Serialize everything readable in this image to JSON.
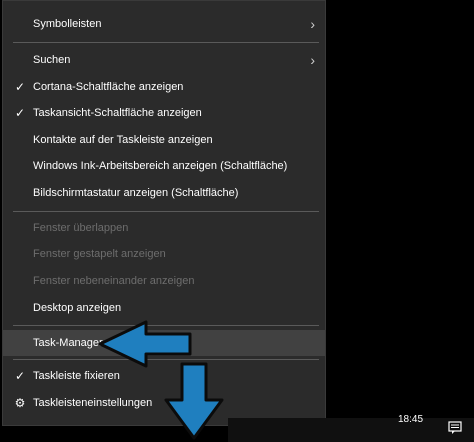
{
  "menu": {
    "items": [
      {
        "label": "Symbolleisten",
        "has_submenu": true
      },
      {
        "label": "Suchen",
        "has_submenu": true
      },
      {
        "label": "Cortana-Schaltfläche anzeigen",
        "checked": true
      },
      {
        "label": "Taskansicht-Schaltfläche anzeigen",
        "checked": true
      },
      {
        "label": "Kontakte auf der Taskleiste anzeigen"
      },
      {
        "label": "Windows Ink-Arbeitsbereich anzeigen (Schaltfläche)"
      },
      {
        "label": "Bildschirmtastatur anzeigen (Schaltfläche)"
      },
      {
        "label": "Fenster überlappen",
        "disabled": true
      },
      {
        "label": "Fenster gestapelt anzeigen",
        "disabled": true
      },
      {
        "label": "Fenster nebeneinander anzeigen",
        "disabled": true
      },
      {
        "label": "Desktop anzeigen"
      },
      {
        "label": "Task-Manager",
        "highlighted": true
      },
      {
        "label": "Taskleiste fixieren",
        "checked": true
      },
      {
        "label": "Taskleisteneinstellungen",
        "icon": "gear-icon"
      }
    ]
  },
  "taskbar": {
    "clock": "18:45",
    "action_center_icon": "notification-icon"
  },
  "annotations": {
    "arrow_color": "#1f7fbf",
    "arrow_stroke": "#0b0b0b"
  }
}
